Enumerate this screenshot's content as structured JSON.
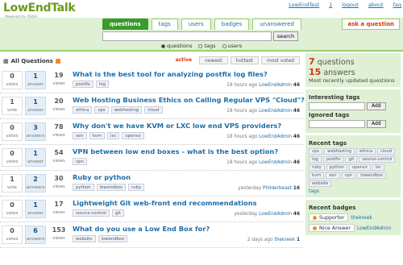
{
  "header": {
    "logo": "LowEndTalk",
    "powered": "Powered by OSQA",
    "user_links": [
      "LowEndTest",
      "1",
      "logout",
      "about",
      "faq"
    ]
  },
  "nav": {
    "tabs": [
      {
        "label": "questions",
        "active": true
      },
      {
        "label": "tags",
        "active": false
      },
      {
        "label": "users",
        "active": false
      },
      {
        "label": "badges",
        "active": false
      },
      {
        "label": "unanswered",
        "active": false
      }
    ],
    "ask_label": "ask a question",
    "search_button": "search",
    "search_value": "",
    "radios": [
      {
        "label": "questions",
        "checked": true
      },
      {
        "label": "tags",
        "checked": false
      },
      {
        "label": "users",
        "checked": false
      }
    ]
  },
  "main": {
    "heading": "All Questions",
    "sorts": [
      {
        "label": "active",
        "on": true
      },
      {
        "label": "newest",
        "on": false
      },
      {
        "label": "hottest",
        "on": false
      },
      {
        "label": "most voted",
        "on": false
      }
    ],
    "stat_labels": {
      "votes": "votes",
      "answer": "answer",
      "answers": "answers",
      "views": "views",
      "vote": "vote"
    },
    "questions": [
      {
        "votes": "0",
        "votes_label": "votes",
        "answers": "1",
        "answers_label": "answer",
        "views": "19",
        "title": "What is the best tool for analyzing postfix log files?",
        "tags": [
          "postfix",
          "log"
        ],
        "time": "18 hours ago",
        "user": "LowEndAdmin",
        "rep": "46"
      },
      {
        "votes": "1",
        "votes_label": "vote",
        "answers": "1",
        "answers_label": "answer",
        "views": "20",
        "title": "Web Hosting Business Ethics on Calling Regular VPS \"Cloud\"?",
        "tags": [
          "ethica",
          "vps",
          "webhosting",
          "cloud"
        ],
        "time": "18 hours ago",
        "user": "LowEndAdmin",
        "rep": "46"
      },
      {
        "votes": "0",
        "votes_label": "votes",
        "answers": "3",
        "answers_label": "answers",
        "views": "78",
        "title": "Why don't we have KVM or LXC low end VPS providers?",
        "tags": [
          "xen",
          "kvm",
          "lxc",
          "openvz"
        ],
        "time": "18 hours ago",
        "user": "LowEndAdmin",
        "rep": "46"
      },
      {
        "votes": "0",
        "votes_label": "votes",
        "answers": "1",
        "answers_label": "answer",
        "views": "54",
        "title": "VPN between low end boxes - what is the best option?",
        "tags": [
          "vpn"
        ],
        "time": "18 hours ago",
        "user": "LowEndAdmin",
        "rep": "46"
      },
      {
        "votes": "1",
        "votes_label": "vote",
        "answers": "2",
        "answers_label": "answers",
        "views": "30",
        "title": "Ruby or python",
        "tags": [
          "python",
          "lowendbox",
          "ruby"
        ],
        "time": "yesterday",
        "user": "Philderbeast",
        "rep": "16"
      },
      {
        "votes": "0",
        "votes_label": "votes",
        "answers": "1",
        "answers_label": "answer",
        "views": "17",
        "title": "Lightweight Git web-front end recommendations",
        "tags": [
          "source-control",
          "git"
        ],
        "time": "yesterday",
        "user": "LowEndAdmin",
        "rep": "46"
      },
      {
        "votes": "0",
        "votes_label": "votes",
        "answers": "6",
        "answers_label": "answers",
        "views": "153",
        "title": "What do you use a Low End Box for?",
        "tags": [
          "website",
          "lowendbox"
        ],
        "time": "2 days ago",
        "user": "thekreek",
        "rep": "1"
      }
    ]
  },
  "sidebar": {
    "questions_count": "7",
    "questions_label": "questions",
    "answers_count": "15",
    "answers_label": "answers",
    "sort_note": "Most recently updated questions",
    "interesting_label": "Interesting tags",
    "ignored_label": "Ignored tags",
    "add_label": "Add",
    "recent_tags_label": "Recent tags",
    "recent_tags": [
      "vps",
      "webhosting",
      "ethica",
      "cloud",
      "log",
      "postfix",
      "git",
      "source-control",
      "ruby",
      "python",
      "openvz",
      "lxc",
      "kvm",
      "xen",
      "vpn",
      "lowendbox",
      "website"
    ],
    "all_tags_link": "tags",
    "recent_badges_label": "Recent badges",
    "badges": [
      {
        "name": "Supporter",
        "user": "thekreek"
      },
      {
        "name": "Nice Answer",
        "user": "LowEndAdmin"
      }
    ],
    "badge_color": "#d4a017"
  },
  "colors": {
    "accent_green": "#3a9a2a",
    "light_green": "#dff0d5",
    "link": "#1f6ea8",
    "orange": "#d9350e"
  }
}
